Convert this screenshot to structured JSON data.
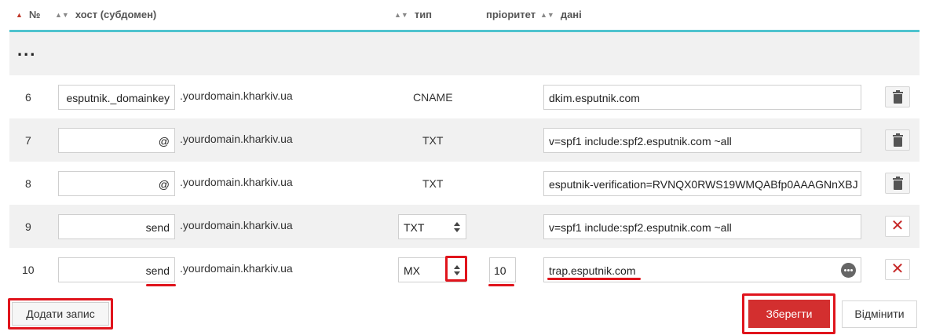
{
  "header": {
    "num_sort_icon": "sort-asc-icon",
    "num_label": "№",
    "host_sort_icon": "sort-icon",
    "host_label": "хост (субдомен)",
    "type_sort_icon": "sort-icon",
    "type_label": "тип",
    "priority_label": "пріоритет",
    "data_sort_icon": "sort-icon",
    "data_label": "дані"
  },
  "collapsed_rows_label": "...",
  "records": [
    {
      "num": "6",
      "host": "esputnik._domainkey",
      "domain": ".yourdomain.kharkiv.ua",
      "type": "CNAME",
      "priority": "",
      "data": "dkim.esputnik.com",
      "action": "delete"
    },
    {
      "num": "7",
      "host": "@",
      "domain": ".yourdomain.kharkiv.ua",
      "type": "TXT",
      "priority": "",
      "data": "v=spf1 include:spf2.esputnik.com ~all",
      "action": "delete"
    },
    {
      "num": "8",
      "host": "@",
      "domain": ".yourdomain.kharkiv.ua",
      "type": "TXT",
      "priority": "",
      "data": "esputnik-verification=RVNQX0RWS19WMQABfp0AAAGNnXBJ",
      "action": "delete"
    },
    {
      "num": "9",
      "host": "send",
      "domain": ".yourdomain.kharkiv.ua",
      "type": "TXT",
      "priority": "",
      "data": "v=spf1 include:spf2.esputnik.com ~all",
      "action": "remove"
    },
    {
      "num": "10",
      "host": "send",
      "domain": ".yourdomain.kharkiv.ua",
      "type": "MX",
      "priority": "10",
      "data": "trap.esputnik.com",
      "action": "remove"
    }
  ],
  "icons": {
    "delete": "trash-icon",
    "remove": "close-icon",
    "more": "more-dots-icon",
    "select": "select-arrows-icon"
  },
  "footer": {
    "add_record_label": "Додати запис",
    "save_label": "Зберегти",
    "cancel_label": "Відмінити"
  },
  "colors": {
    "accent_line": "#4fc3cf",
    "primary_button": "#d32f2f",
    "highlight": "#e0141c",
    "row_alt": "#f1f1f1"
  }
}
